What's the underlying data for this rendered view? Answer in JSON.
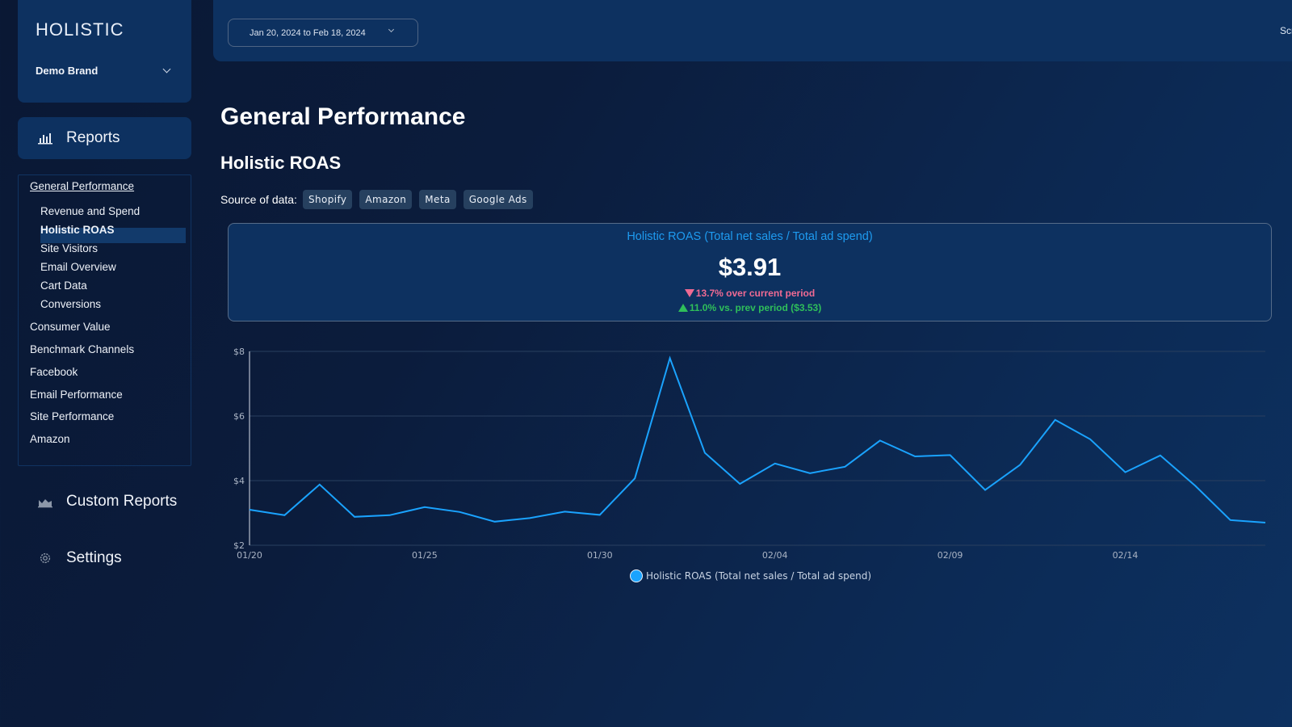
{
  "sidebar": {
    "brand": "HOLISTIC",
    "brand_selector": "Demo Brand",
    "reports": {
      "label": "Reports",
      "icon": "bar-chart-icon"
    },
    "nav": [
      {
        "label": "General Performance",
        "level": "group",
        "selected": true
      },
      {
        "label": "Revenue and Spend",
        "level": "child"
      },
      {
        "label": "Holistic ROAS",
        "level": "child",
        "active": true
      },
      {
        "label": "Site Visitors",
        "level": "child"
      },
      {
        "label": "Email Overview",
        "level": "child"
      },
      {
        "label": "Cart Data",
        "level": "child"
      },
      {
        "label": "Conversions",
        "level": "child"
      },
      {
        "label": "Consumer Value",
        "level": "group"
      },
      {
        "label": "Benchmark Channels",
        "level": "group"
      },
      {
        "label": "Facebook",
        "level": "group"
      },
      {
        "label": "Email Performance",
        "level": "group"
      },
      {
        "label": "Site Performance",
        "level": "group"
      },
      {
        "label": "Amazon",
        "level": "group"
      }
    ],
    "custom_reports": {
      "label": "Custom Reports",
      "icon": "area-chart-icon"
    },
    "settings": {
      "label": "Settings",
      "icon": "gear-icon"
    }
  },
  "header": {
    "date_range": "Jan 20, 2024 to Feb 18, 2024",
    "truncated_right_text": "Scr"
  },
  "main": {
    "page_title": "General Performance",
    "section_title": "Holistic ROAS",
    "source_label": "Source of data:",
    "sources": [
      "Shopify",
      "Amazon",
      "Meta",
      "Google Ads"
    ]
  },
  "kpi": {
    "title": "Holistic ROAS (Total net sales / Total ad spend)",
    "value": "$3.91",
    "delta_current": "13.7% over current period",
    "delta_prev": "11.0% vs. prev period ($3.53)",
    "colors": {
      "title": "#1e9bf0",
      "down": "#ef6a93",
      "up": "#2fbf5a"
    }
  },
  "chart_data": {
    "type": "line",
    "title": "",
    "xlabel": "",
    "ylabel": "",
    "x": [
      "01/20",
      "01/21",
      "01/22",
      "01/23",
      "01/24",
      "01/25",
      "01/26",
      "01/27",
      "01/28",
      "01/29",
      "01/30",
      "01/31",
      "02/01",
      "02/02",
      "02/03",
      "02/04",
      "02/05",
      "02/06",
      "02/07",
      "02/08",
      "02/09",
      "02/10",
      "02/11",
      "02/12",
      "02/13",
      "02/14",
      "02/15",
      "02/16",
      "02/17",
      "02/18"
    ],
    "x_tick_labels": [
      "01/20",
      "01/25",
      "01/30",
      "02/04",
      "02/09",
      "02/14"
    ],
    "y_tick_labels": [
      "$2",
      "$4",
      "$6",
      "$8"
    ],
    "ylim": [
      2,
      8
    ],
    "grid": true,
    "legend_position": "bottom-center",
    "series": [
      {
        "name": "Holistic ROAS (Total net sales / Total ad spend)",
        "color": "#1aa3ff",
        "values": [
          3.1,
          2.93,
          3.88,
          2.88,
          2.93,
          3.18,
          3.03,
          2.73,
          2.84,
          3.04,
          2.94,
          4.07,
          7.79,
          4.86,
          3.9,
          4.53,
          4.23,
          4.43,
          5.24,
          4.75,
          4.79,
          3.71,
          4.49,
          5.88,
          5.28,
          4.26,
          4.78,
          3.84,
          2.78,
          2.7
        ]
      }
    ]
  }
}
